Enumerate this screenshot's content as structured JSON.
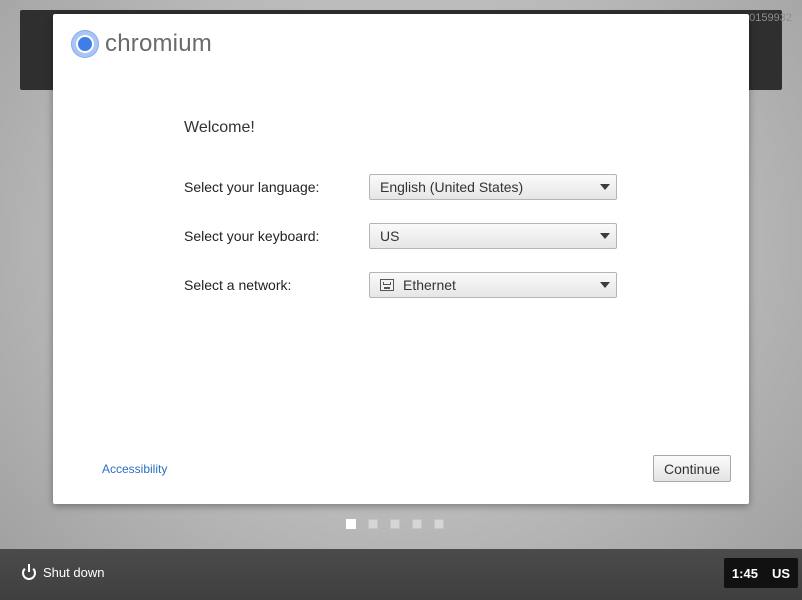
{
  "build_tag": "0159932",
  "logo": {
    "text": "chromium",
    "icon": "chromium-logo-icon"
  },
  "welcome_title": "Welcome!",
  "fields": {
    "language": {
      "label": "Select your language:",
      "value": "English (United States)"
    },
    "keyboard": {
      "label": "Select your keyboard:",
      "value": "US"
    },
    "network": {
      "label": "Select a network:",
      "value": "Ethernet",
      "icon": "ethernet-icon"
    }
  },
  "accessibility_link": "Accessibility",
  "continue_button": "Continue",
  "progress": {
    "current_step": 1,
    "total_steps": 5
  },
  "shelf": {
    "shutdown_label": "Shut down",
    "shutdown_icon": "power-icon",
    "time": "1:45",
    "input_method": "US"
  },
  "colors": {
    "link": "#2a6ec2",
    "shelf": "#444444",
    "logo_blue": "#3f7de8"
  }
}
